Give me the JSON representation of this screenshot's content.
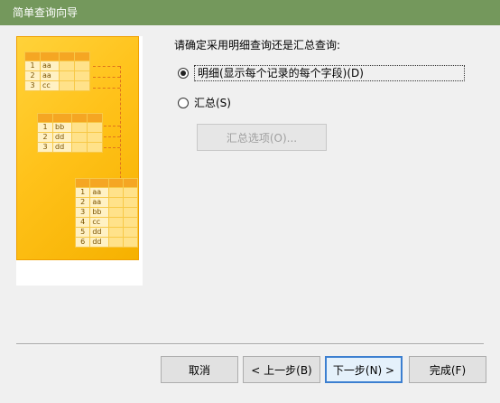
{
  "window": {
    "title": "简单查询向导"
  },
  "prompt": "请确定采用明细查询还是汇总查询:",
  "options": {
    "detail": {
      "label": "明细(显示每个记录的每个字段)(D)",
      "selected": true
    },
    "summary": {
      "label": "汇总(S)",
      "selected": false
    }
  },
  "summary_options_button": "汇总选项(O)...",
  "buttons": {
    "cancel": "取消",
    "back": "< 上一步(B)",
    "next": "下一步(N) >",
    "finish": "完成(F)"
  },
  "illustration": {
    "table1": [
      [
        "1",
        "aa"
      ],
      [
        "2",
        "aa"
      ],
      [
        "3",
        "cc"
      ]
    ],
    "table2": [
      [
        "1",
        "bb"
      ],
      [
        "2",
        "dd"
      ],
      [
        "3",
        "dd"
      ]
    ],
    "table3": [
      [
        "1",
        "aa"
      ],
      [
        "2",
        "aa"
      ],
      [
        "3",
        "bb"
      ],
      [
        "4",
        "cc"
      ],
      [
        "5",
        "dd"
      ],
      [
        "6",
        "dd"
      ]
    ]
  }
}
